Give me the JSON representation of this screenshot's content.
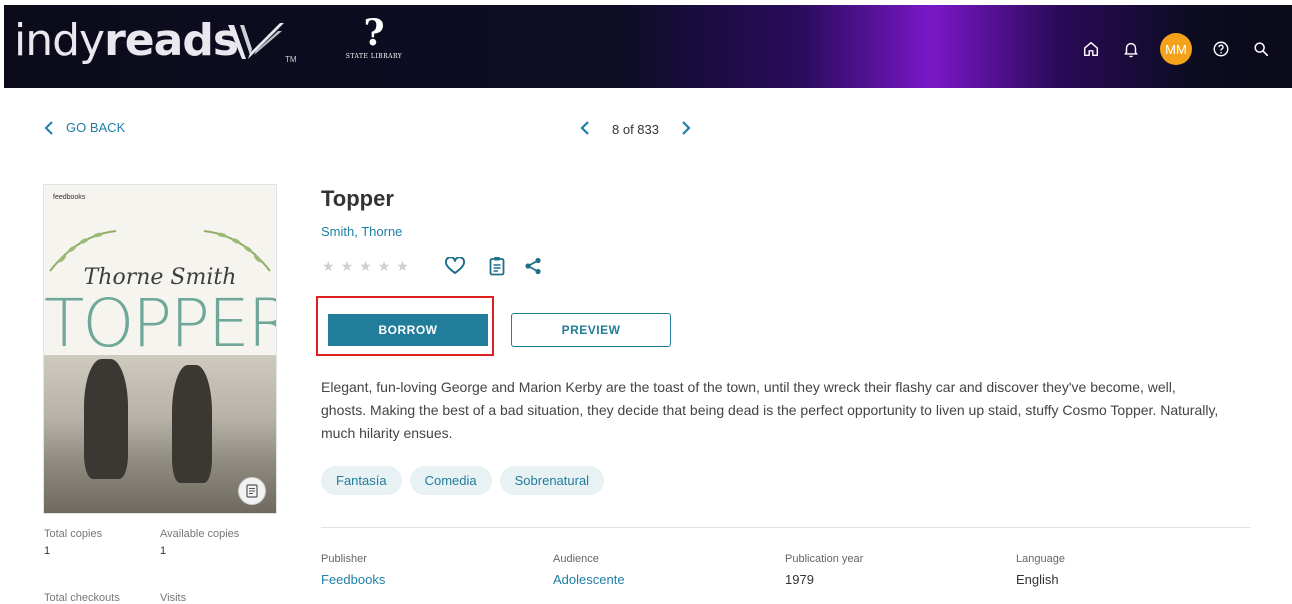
{
  "header": {
    "brand": "indyreads",
    "trademark": "TM",
    "partner_logo_text": "STATE LIBRARY",
    "avatar_initials": "MM",
    "icons": [
      "home-icon",
      "bell-icon",
      "help-icon",
      "search-icon"
    ]
  },
  "nav": {
    "go_back": "GO BACK",
    "pager": "8 of 833"
  },
  "cover": {
    "publisher_mark": "feedbooks",
    "author": "Thorne Smith",
    "title": "TOPPER"
  },
  "book": {
    "title": "Topper",
    "author": "Smith, Thorne",
    "rating": 0,
    "rating_max": 5,
    "borrow_label": "BORROW",
    "preview_label": "PREVIEW",
    "description": "Elegant, fun-loving George and Marion Kerby are the toast of the town, until they wreck their flashy car and discover they've become, well, ghosts. Making the best of a bad situation, they decide that being dead is the perfect opportunity to liven up staid, stuffy Cosmo Topper. Naturally, much hilarity ensues.",
    "tags": [
      "Fantasía",
      "Comedia",
      "Sobrenatural"
    ]
  },
  "stats": {
    "total_copies_label": "Total copies",
    "total_copies": "1",
    "available_copies_label": "Available copies",
    "available_copies": "1",
    "total_checkouts_label": "Total checkouts",
    "visits_label": "Visits"
  },
  "details": {
    "publisher_label": "Publisher",
    "publisher": "Feedbooks",
    "audience_label": "Audience",
    "audience": "Adolescente",
    "year_label": "Publication year",
    "year": "1979",
    "language_label": "Language",
    "language": "English"
  },
  "colors": {
    "accent": "#217d99",
    "link": "#1f7fa6",
    "avatar": "#f5a21b",
    "highlight": "#e01f1f"
  }
}
